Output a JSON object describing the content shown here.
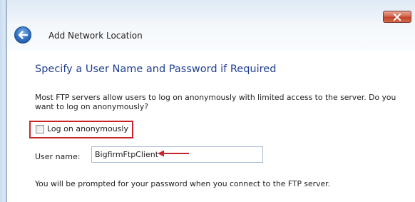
{
  "window": {
    "title": "Add Network Location"
  },
  "icons": {
    "back": "back-arrow-icon",
    "close": "close-icon"
  },
  "main": {
    "heading": "Specify a User Name and Password if Required",
    "description": "Most FTP servers allow users to log on anonymously with limited access to the server.  Do you want to log on anonymously?",
    "anonymous_checkbox": {
      "label": "Log on anonymously",
      "checked": false
    },
    "username": {
      "label": "User name:",
      "value": "BigfirmFtpClient"
    },
    "prompt_note": "You will be prompted for your password when you connect to the FTP server."
  },
  "colors": {
    "heading": "#1f3f8f",
    "highlight_box": "#c8252a",
    "annotation_arrow": "#c8252a",
    "close_button": "#c3432a"
  }
}
